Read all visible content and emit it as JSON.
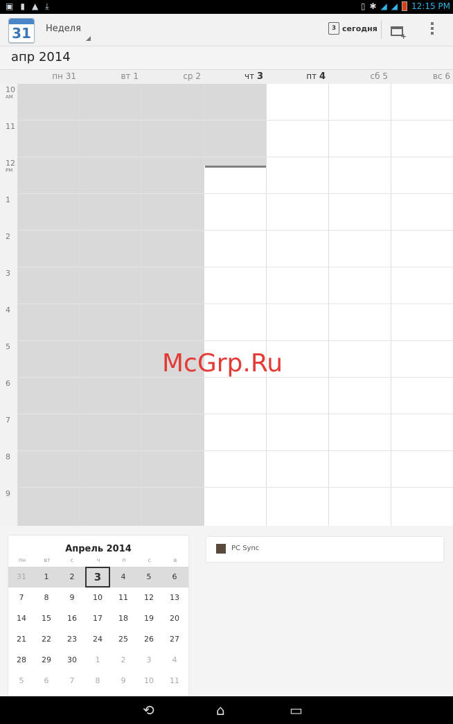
{
  "statusbar": {
    "left_icons": [
      "image-icon",
      "sd-icon",
      "warning-icon",
      "download-icon"
    ],
    "time": "12:15 PM"
  },
  "actionbar": {
    "app_icon_number": "31",
    "view_mode": "Неделя",
    "today_icon_number": "3",
    "today_label": "сегодня"
  },
  "month_title": "апр 2014",
  "week": {
    "days": [
      {
        "dow": "пн",
        "num": "31",
        "past": true
      },
      {
        "dow": "вт",
        "num": "1",
        "past": true
      },
      {
        "dow": "ср",
        "num": "2",
        "past": true
      },
      {
        "dow": "чт",
        "num": "3",
        "today": true
      },
      {
        "dow": "пт",
        "num": "4"
      },
      {
        "dow": "сб",
        "num": "5"
      },
      {
        "dow": "вс",
        "num": "6"
      }
    ],
    "hours": [
      {
        "h": "10",
        "ampm": "AM"
      },
      {
        "h": "11",
        "ampm": ""
      },
      {
        "h": "12",
        "ampm": "PM"
      },
      {
        "h": "1",
        "ampm": ""
      },
      {
        "h": "2",
        "ampm": ""
      },
      {
        "h": "3",
        "ampm": ""
      },
      {
        "h": "4",
        "ampm": ""
      },
      {
        "h": "5",
        "ampm": ""
      },
      {
        "h": "6",
        "ampm": ""
      },
      {
        "h": "7",
        "ampm": ""
      },
      {
        "h": "8",
        "ampm": ""
      },
      {
        "h": "9",
        "ampm": ""
      }
    ]
  },
  "watermark": "McGrp.Ru",
  "mini_calendar": {
    "title": "Апрель 2014",
    "weekdays": [
      "пн",
      "вт",
      "с",
      "ч",
      "п",
      "с",
      "в"
    ],
    "weeks": [
      [
        "31",
        "1",
        "2",
        "3",
        "4",
        "5",
        "6"
      ],
      [
        "7",
        "8",
        "9",
        "10",
        "11",
        "12",
        "13"
      ],
      [
        "14",
        "15",
        "16",
        "17",
        "18",
        "19",
        "20"
      ],
      [
        "21",
        "22",
        "23",
        "24",
        "25",
        "26",
        "27"
      ],
      [
        "28",
        "29",
        "30",
        "1",
        "2",
        "3",
        "4"
      ],
      [
        "5",
        "6",
        "7",
        "8",
        "9",
        "10",
        "11"
      ]
    ],
    "today": "3"
  },
  "calendars": [
    {
      "name": "PC Sync",
      "color": "#5a4a3c"
    }
  ],
  "navbar": [
    "back-icon",
    "home-icon",
    "recent-apps-icon"
  ]
}
